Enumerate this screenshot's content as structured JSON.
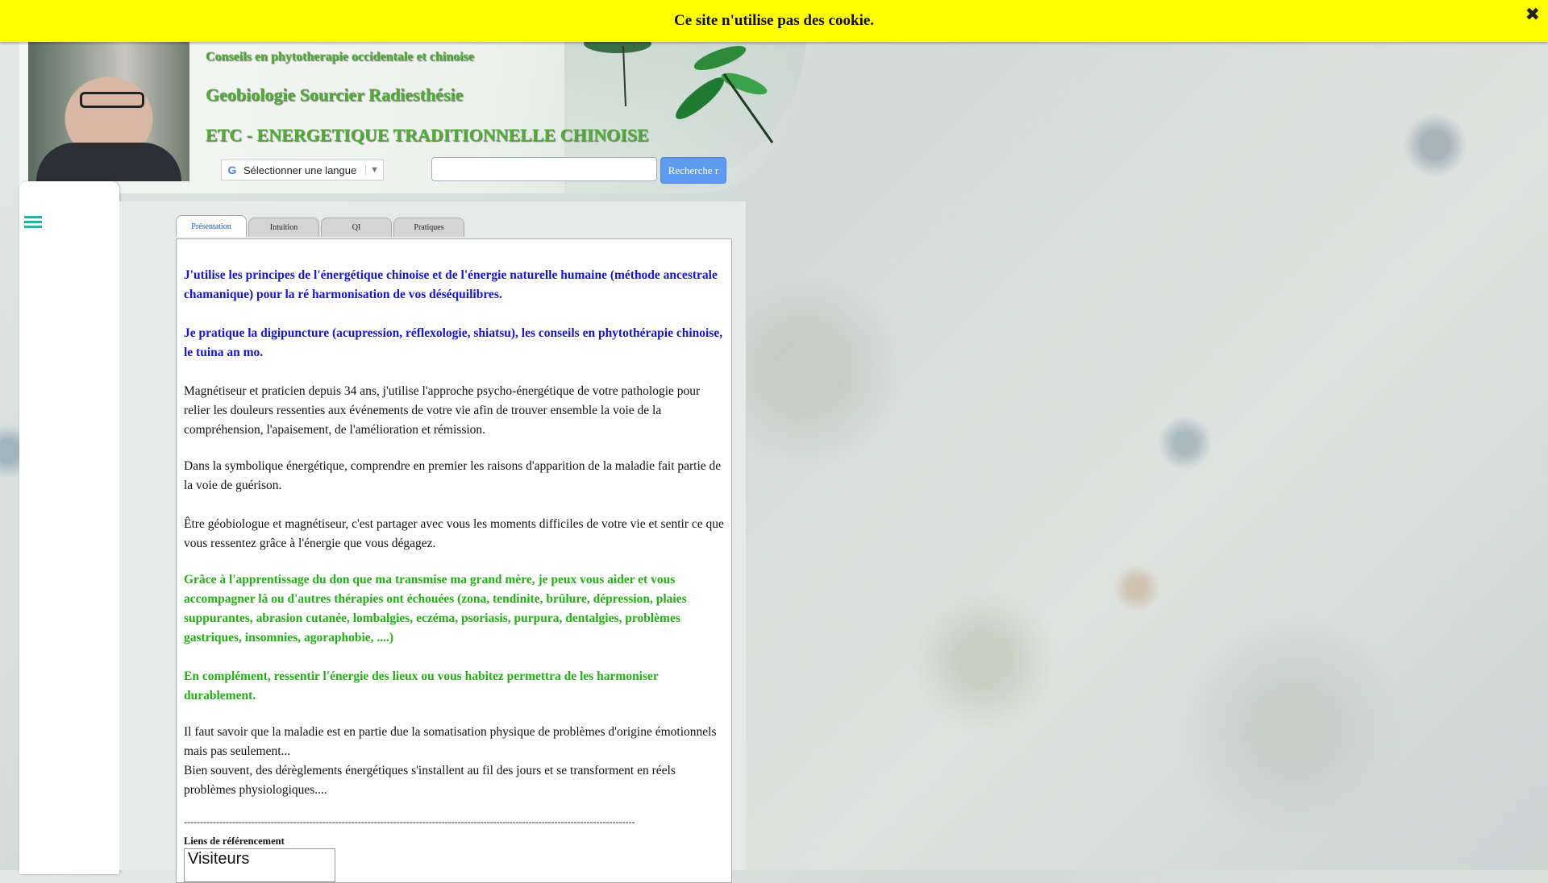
{
  "cookie": {
    "message": "Ce site n'utilise pas des cookie.",
    "close_glyph": "✖"
  },
  "header": {
    "line1": "Conseils en phytotherapie occidentale et chinoise",
    "line2": "Geobiologie Sourcier Radiesthésie",
    "line3": "ETC - ENERGETIQUE TRADITIONNELLE CHINOISE",
    "language_select": "Sélectionner une langue",
    "search_placeholder": "",
    "search_button": "Recherche r"
  },
  "tabs": [
    {
      "label": "Présentation",
      "active": true
    },
    {
      "label": "Intuition",
      "active": false
    },
    {
      "label": "QI",
      "active": false
    },
    {
      "label": "Pratiques",
      "active": false
    }
  ],
  "content": {
    "p1": "J'utilise les principes de l'énergétique chinoise et de l'énergie naturelle humaine (méthode ancestrale chamanique) pour la ré harmonisation de vos déséquilibres.",
    "p2": "Je pratique la digipuncture (acupression, réflexologie, shiatsu), les conseils en phytothérapie chinoise, le tuina an mo.",
    "p3": "Magnétiseur et praticien depuis 34 ans, j'utilise l'approche psycho-énergétique de votre pathologie pour relier les douleurs ressenties aux événements de votre vie afin de trouver ensemble la voie de la compréhension, l'apaisement, de l'amélioration et rémission.",
    "p4": "Dans la symbolique énergétique, comprendre en premier les raisons d'apparition de la maladie fait partie de la voie de guérison.",
    "p5": "Être géobiologue et magnétiseur, c'est partager avec vous les moments difficiles de votre vie et sentir ce que vous ressentez grâce à l'énergie que vous dégagez.",
    "p6": "Grâce à l'apprentissage du don que ma transmise ma grand mère, je peux vous aider et vous accompagner là ou d'autres thérapies ont échouées (zona, tendinite, brûlure, dépression, plaies suppurantes, abrasion cutanée, lombalgies, eczéma, psoriasis, purpura, dentalgies, problèmes gastriques, insomnies, agoraphobie, ....)",
    "p7": "En complément, ressentir l'énergie des lieux ou vous habitez permettra de les harmoniser durablement.",
    "p8": "Il faut savoir que la maladie est en partie due la somatisation physique de problèmes d'origine émotionnels mais pas seulement...",
    "p9": "Bien souvent, des dérèglements énergétiques s'installent au fil des jours et se transforment en réels problèmes physiologiques....",
    "dashes": "--------------------------------------------------------------------------------------------------------------------------------------------",
    "ref_title": "Liens de référencement",
    "visitors": "Visiteurs"
  },
  "colors": {
    "cookie_bar": "#ffff00",
    "header_text": "#4fae34",
    "blue_text": "#1414d8",
    "green_text": "#22b014",
    "button": "#5e9bef",
    "menu_icon": "#2bb0a0"
  },
  "icons": [
    "close-icon",
    "google-icon",
    "hamburger-menu-icon",
    "dragonfly-icon"
  ]
}
